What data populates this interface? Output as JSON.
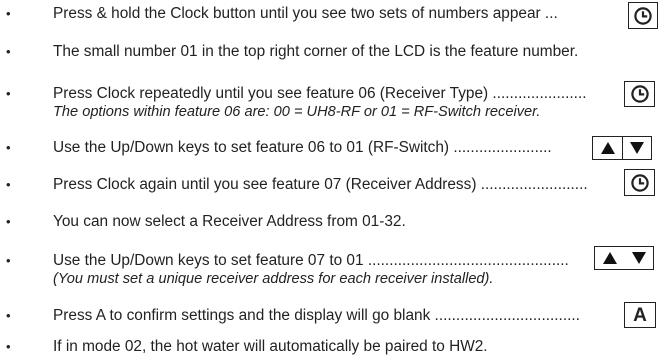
{
  "bullet_char": "•",
  "steps": [
    {
      "text": "Press & hold the Clock button until you see two sets of numbers appear ...",
      "key": "clock-icon"
    },
    {
      "text": "The small number 01 in the top right corner of the LCD is the feature number."
    },
    {
      "text": "Press Clock repeatedly until you see feature 06 (Receiver Type) ......................",
      "sub": "The options within feature 06 are: 00 = UH8-RF or 01 = RF-Switch receiver.",
      "key": "clock-icon"
    },
    {
      "text": "Use the Up/Down keys to set feature 06 to 01 (RF-Switch) .......................",
      "keys": [
        "up-arrow-icon",
        "down-arrow-icon"
      ]
    },
    {
      "text": "Press Clock again until you see feature 07 (Receiver Address) .........................",
      "key": "clock-icon"
    },
    {
      "text": "You can now select a Receiver Address from 01-32."
    },
    {
      "text": "Use the Up/Down keys to set feature 07 to 01 ...............................................",
      "sub": "(You must set a unique receiver address for each receiver installed).",
      "keys": [
        "up-arrow-icon",
        "down-arrow-icon"
      ]
    },
    {
      "text": "Press A to confirm settings and the display will go blank ..................................",
      "key_label": "A"
    },
    {
      "text": "If in mode 02, the hot water will automatically be paired to HW2."
    }
  ]
}
